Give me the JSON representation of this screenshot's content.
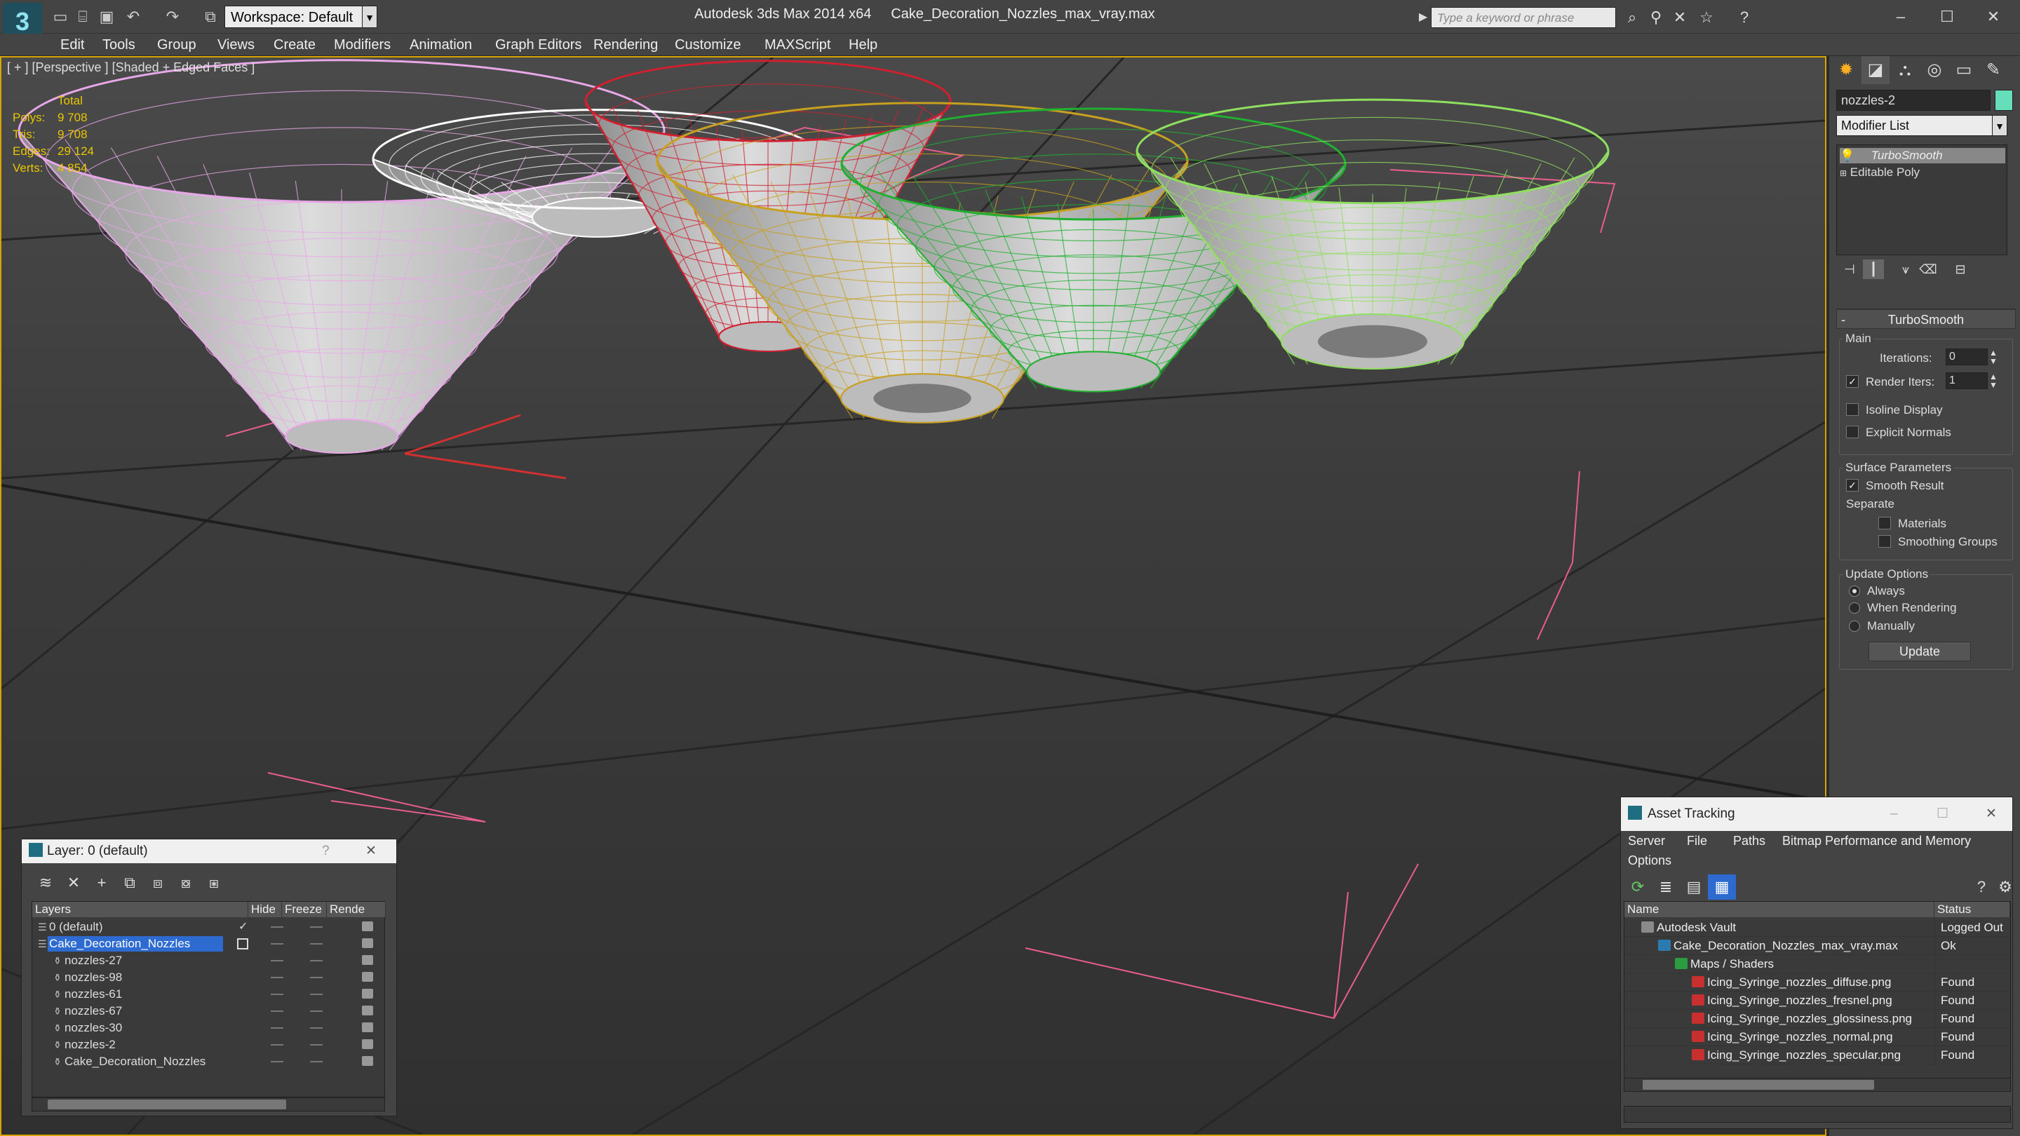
{
  "app": {
    "title": "Autodesk 3ds Max 2014 x64",
    "file": "Cake_Decoration_Nozzles_max_vray.max",
    "logo": "3",
    "workspace": "Workspace: Default",
    "search_placeholder": "Type a keyword or phrase"
  },
  "menus": [
    "Edit",
    "Tools",
    "Group",
    "Views",
    "Create",
    "Modifiers",
    "Animation",
    "Graph Editors",
    "Rendering",
    "Customize",
    "MAXScript",
    "Help"
  ],
  "viewport": {
    "label": "[ + ] [Perspective ] [Shaded + Edged Faces ]",
    "stats": {
      "header": "Total",
      "rows": [
        {
          "k": "Polys:",
          "v": "9 708"
        },
        {
          "k": "Tris:",
          "v": "9 708"
        },
        {
          "k": "Edges:",
          "v": "29 124"
        },
        {
          "k": "Verts:",
          "v": "4 854"
        }
      ]
    },
    "objects": [
      {
        "name": "nozzles-27",
        "wire": "#e8a8e8"
      },
      {
        "name": "nozzles-98",
        "wire": "#ffffff"
      },
      {
        "name": "nozzles-61",
        "wire": "#d02030"
      },
      {
        "name": "nozzles-67",
        "wire": "#c8a020"
      },
      {
        "name": "nozzles-30",
        "wire": "#20b030"
      },
      {
        "name": "nozzles-2",
        "wire": "#90e060"
      }
    ]
  },
  "command": {
    "object_name": "nozzles-2",
    "object_color": "#66ddbb",
    "modifier_list": "Modifier List",
    "stack": [
      "TurboSmooth",
      "Editable Poly"
    ],
    "turbosmooth": {
      "title": "TurboSmooth",
      "main": "Main",
      "iterations_label": "Iterations:",
      "iterations": "0",
      "render_iters_label": "Render Iters:",
      "render_iters": "1",
      "isoline": "Isoline Display",
      "explicit": "Explicit Normals",
      "surface": "Surface Parameters",
      "smooth": "Smooth Result",
      "separate": "Separate",
      "materials": "Materials",
      "smoothing": "Smoothing Groups",
      "update_options": "Update Options",
      "always": "Always",
      "when_rendering": "When Rendering",
      "manually": "Manually",
      "update": "Update"
    }
  },
  "layer": {
    "title": "Layer: 0 (default)",
    "help": "?",
    "close": "✕",
    "cols": [
      "Layers",
      "Hide",
      "Freeze",
      "Rende"
    ],
    "rows": [
      {
        "name": "0 (default)",
        "check": "✓"
      },
      {
        "name": "Cake_Decoration_Nozzles",
        "sel": true
      },
      {
        "name": "nozzles-27"
      },
      {
        "name": "nozzles-98"
      },
      {
        "name": "nozzles-61"
      },
      {
        "name": "nozzles-67"
      },
      {
        "name": "nozzles-30"
      },
      {
        "name": "nozzles-2"
      },
      {
        "name": "Cake_Decoration_Nozzles"
      }
    ]
  },
  "asset": {
    "title": "Asset Tracking",
    "menus": [
      "Server",
      "File",
      "Paths",
      "Bitmap Performance and Memory"
    ],
    "options": "Options",
    "cols": [
      "Name",
      "Status"
    ],
    "rows": [
      {
        "name": "Autodesk Vault",
        "status": "Logged Out",
        "level": 0
      },
      {
        "name": "Cake_Decoration_Nozzles_max_vray.max",
        "status": "Ok",
        "level": 1
      },
      {
        "name": "Maps / Shaders",
        "status": "",
        "level": 2
      },
      {
        "name": "Icing_Syringe_nozzles_diffuse.png",
        "status": "Found",
        "level": 3
      },
      {
        "name": "Icing_Syringe_nozzles_fresnel.png",
        "status": "Found",
        "level": 3
      },
      {
        "name": "Icing_Syringe_nozzles_glossiness.png",
        "status": "Found",
        "level": 3
      },
      {
        "name": "Icing_Syringe_nozzles_normal.png",
        "status": "Found",
        "level": 3
      },
      {
        "name": "Icing_Syringe_nozzles_specular.png",
        "status": "Found",
        "level": 3
      }
    ]
  }
}
